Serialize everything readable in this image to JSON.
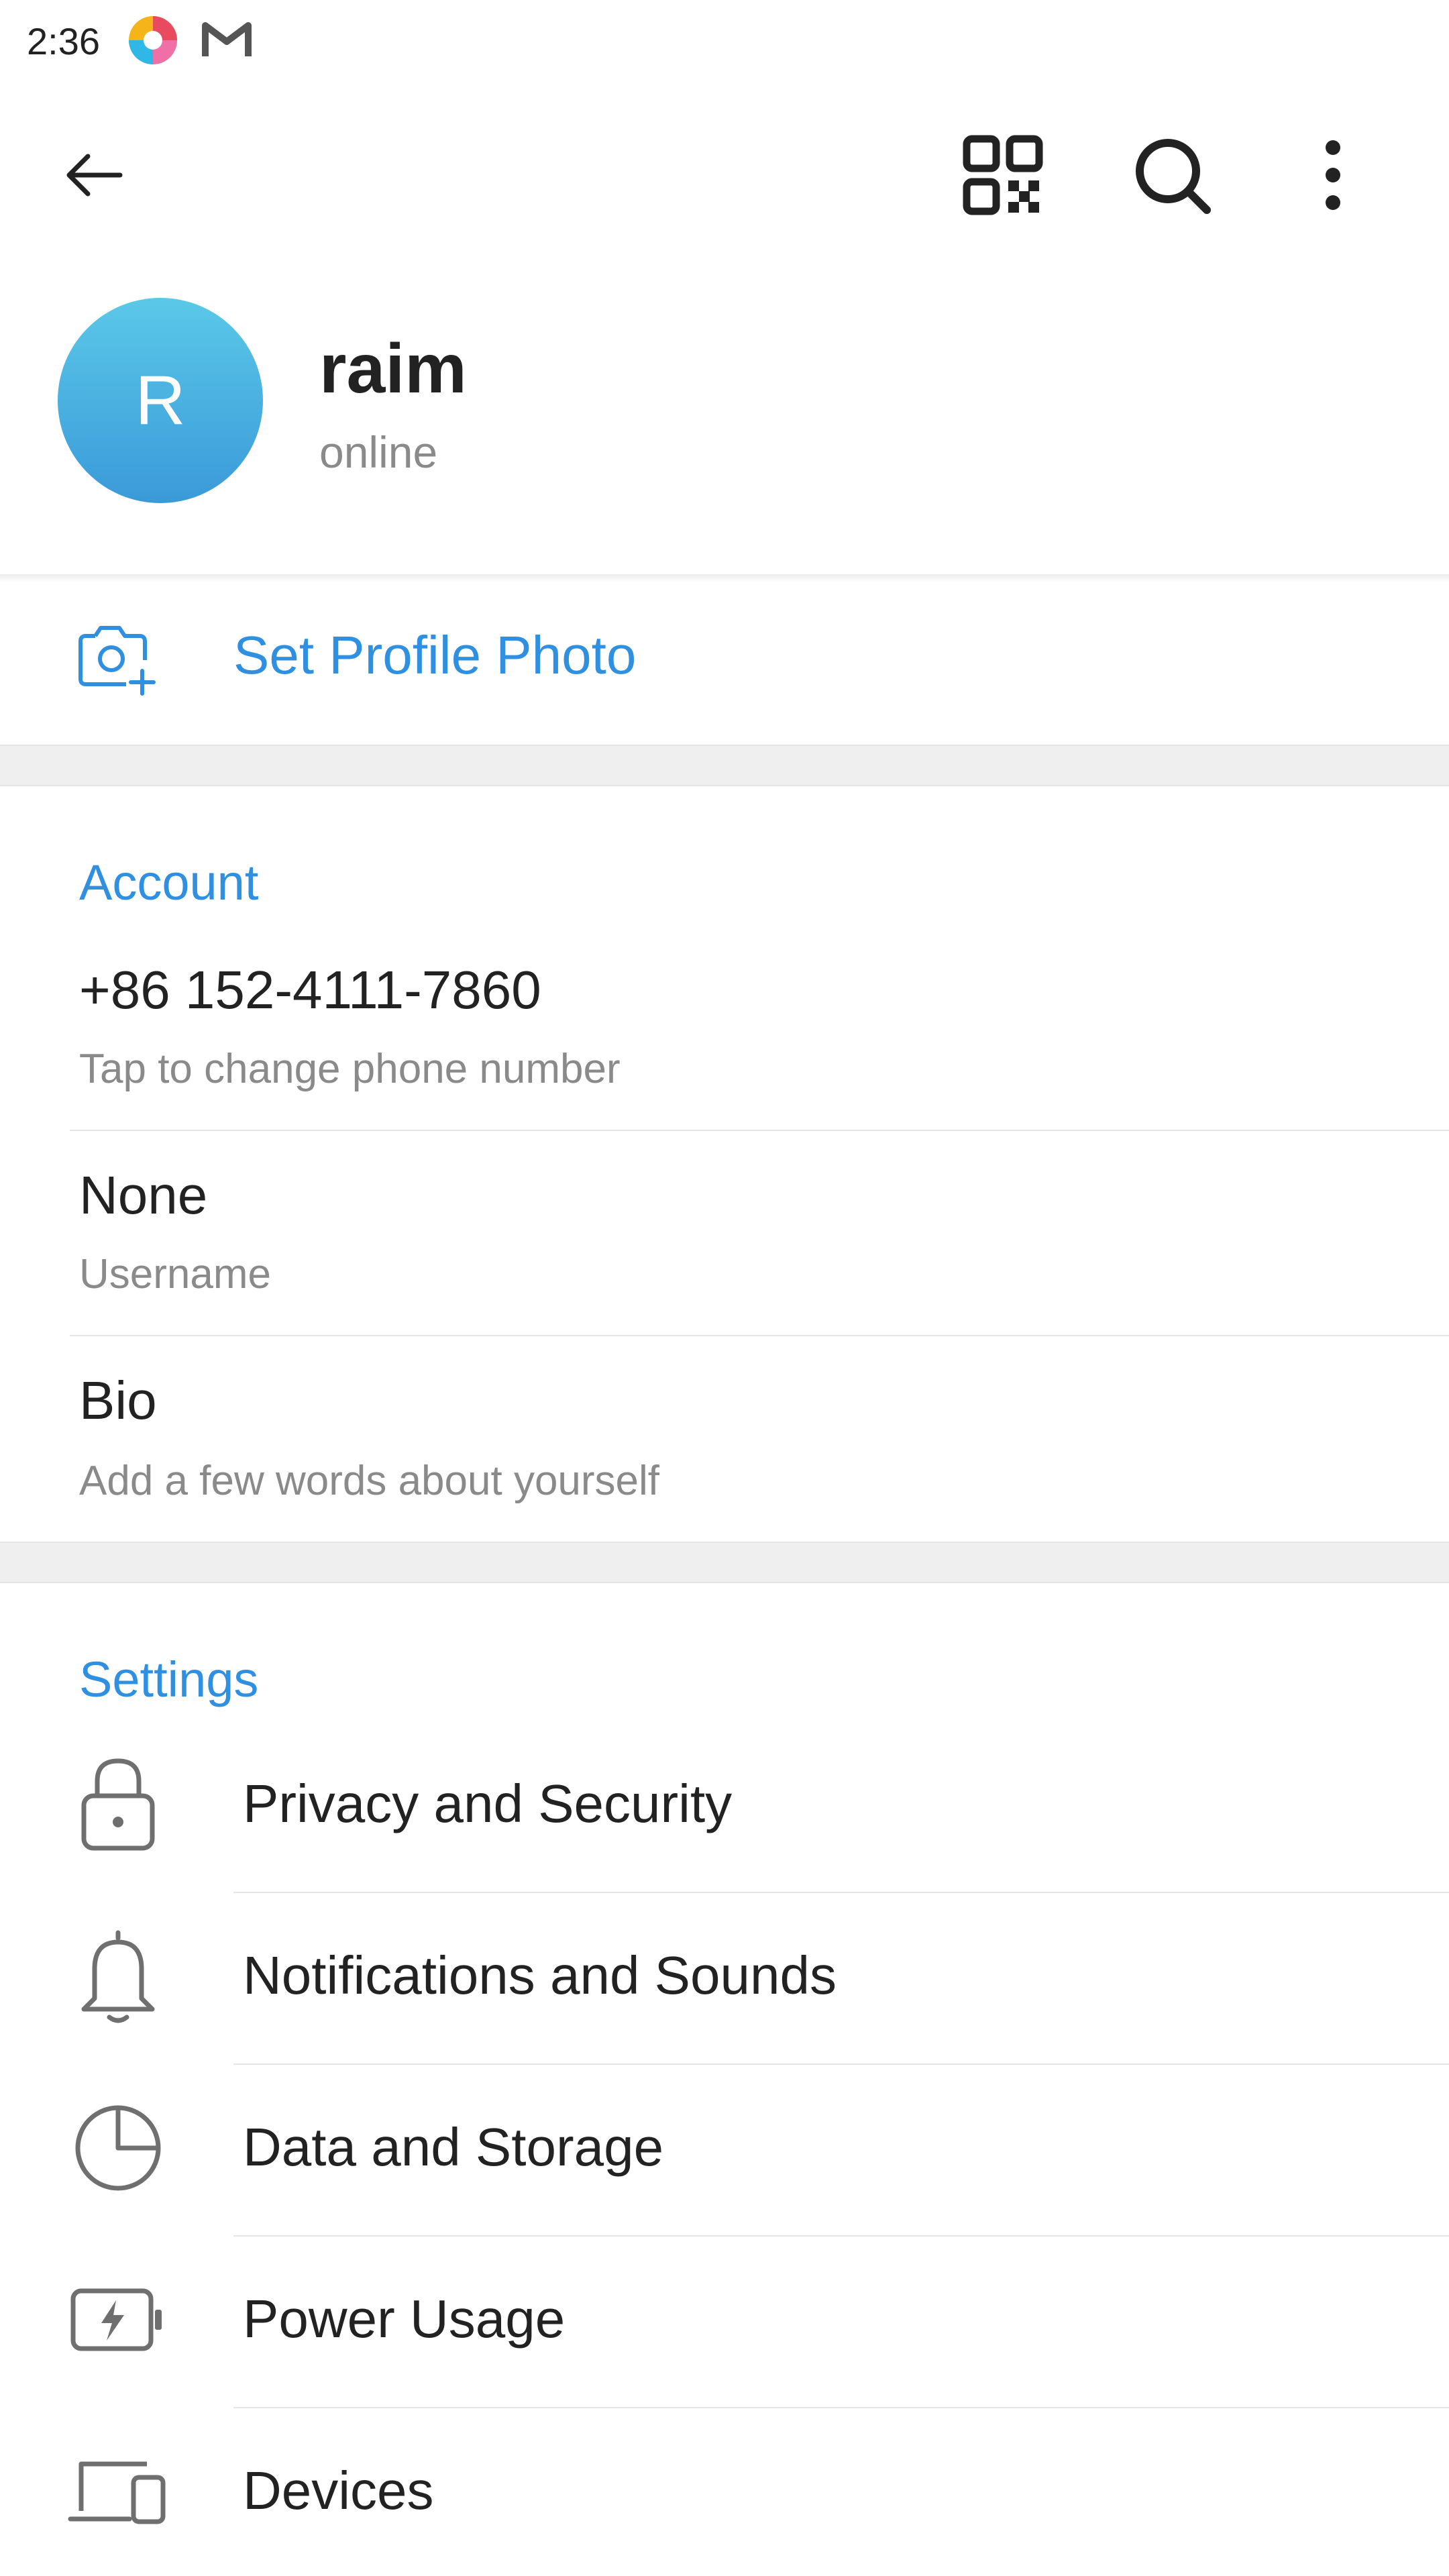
{
  "status_bar": {
    "time": "2:36",
    "icons": [
      "colorful-app-icon",
      "gmail-icon"
    ]
  },
  "topbar": {
    "icons": [
      "back-arrow-icon",
      "qr-code-icon",
      "search-icon",
      "more-vert-icon"
    ]
  },
  "profile": {
    "avatar_initial": "R",
    "name": "raim",
    "status": "online",
    "avatar_gradient": [
      "#5bc8e8",
      "#3a9ad9"
    ]
  },
  "set_photo": {
    "label": "Set Profile Photo",
    "icon": "camera-add-icon"
  },
  "account": {
    "header": "Account",
    "phone": {
      "value": "+86 152-4111-7860",
      "hint": "Tap to change phone number"
    },
    "username": {
      "value": "None",
      "hint": "Username"
    },
    "bio": {
      "value": "Bio",
      "hint": "Add a few words about yourself"
    }
  },
  "settings": {
    "header": "Settings",
    "items": [
      {
        "label": "Privacy and Security",
        "icon": "lock-icon"
      },
      {
        "label": "Notifications and Sounds",
        "icon": "bell-icon"
      },
      {
        "label": "Data and Storage",
        "icon": "pie-chart-icon"
      },
      {
        "label": "Power Usage",
        "icon": "battery-bolt-icon"
      },
      {
        "label": "Devices",
        "icon": "devices-icon"
      }
    ]
  },
  "colors": {
    "accent": "#2f8fe0",
    "text_primary": "#222222",
    "text_secondary": "#8a8a8a",
    "section_gap": "#efefef"
  }
}
